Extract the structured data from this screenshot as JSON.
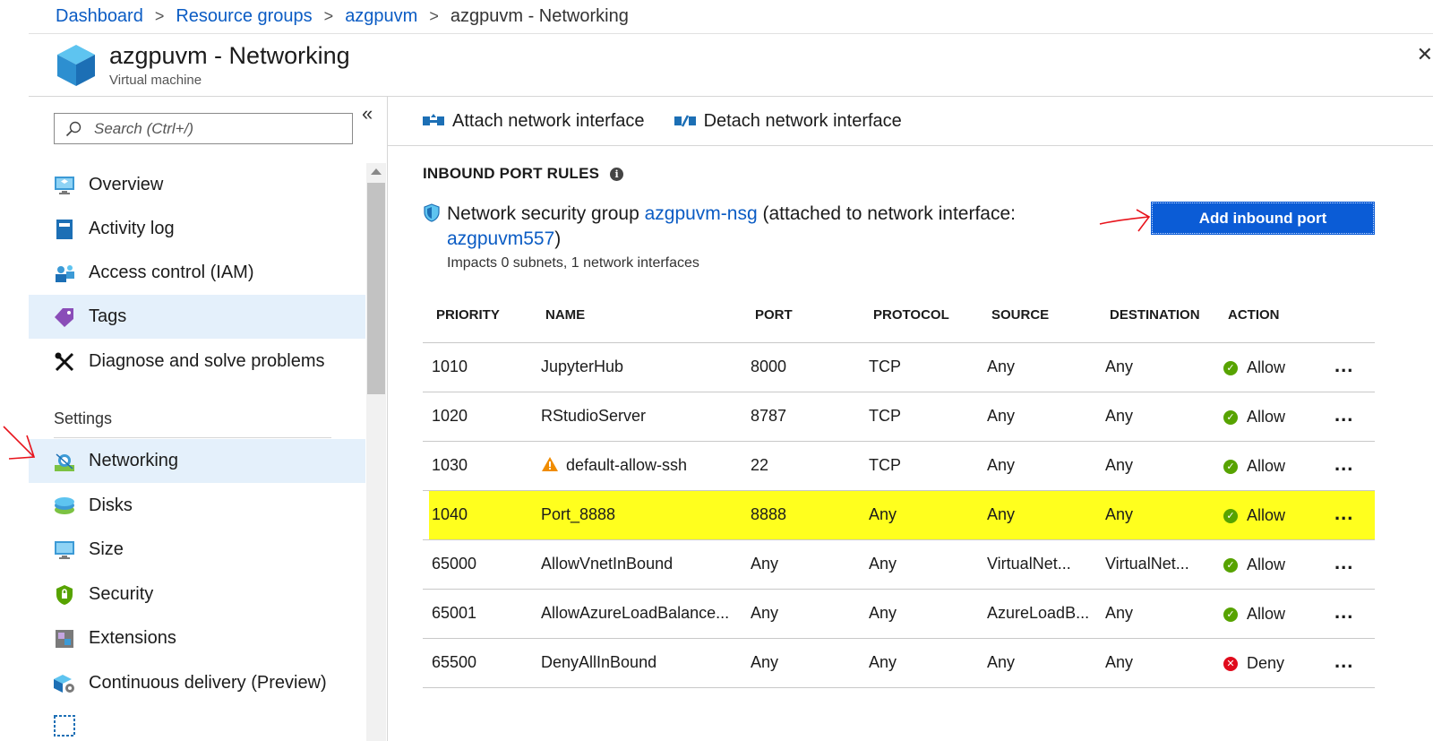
{
  "breadcrumb": {
    "items": [
      "Dashboard",
      "Resource groups",
      "azgpuvm"
    ],
    "current": "azgpuvm - Networking"
  },
  "header": {
    "title": "azgpuvm - Networking",
    "subtitle": "Virtual machine",
    "close_glyph": "✕"
  },
  "sidebar": {
    "search_placeholder": "Search (Ctrl+/)",
    "collapse_glyph": "«",
    "items": [
      {
        "label": "Overview",
        "icon": "monitor-icon"
      },
      {
        "label": "Activity log",
        "icon": "book-icon"
      },
      {
        "label": "Access control (IAM)",
        "icon": "people-icon"
      },
      {
        "label": "Tags",
        "icon": "tag-icon"
      },
      {
        "label": "Diagnose and solve problems",
        "icon": "wrench-icon"
      }
    ],
    "settings_label": "Settings",
    "settings_items": [
      {
        "label": "Networking",
        "icon": "network-icon"
      },
      {
        "label": "Disks",
        "icon": "disk-icon"
      },
      {
        "label": "Size",
        "icon": "monitor-icon"
      },
      {
        "label": "Security",
        "icon": "shield-icon"
      },
      {
        "label": "Extensions",
        "icon": "extensions-icon"
      },
      {
        "label": "Continuous delivery (Preview)",
        "icon": "delivery-icon"
      }
    ],
    "active": "Networking"
  },
  "toolbar": {
    "attach_label": "Attach network interface",
    "detach_label": "Detach network interface"
  },
  "inbound": {
    "title": "INBOUND PORT RULES",
    "nsg_prefix": "Network security group",
    "nsg_link": "azgpuvm-nsg",
    "nsg_middle": "(attached to network interface:",
    "nic_link": "azgpuvm557",
    "nsg_suffix": ")",
    "impacts": "Impacts 0 subnets, 1 network interfaces",
    "add_button": "Add inbound port"
  },
  "table": {
    "columns": [
      "PRIORITY",
      "NAME",
      "PORT",
      "PROTOCOL",
      "SOURCE",
      "DESTINATION",
      "ACTION"
    ],
    "rows": [
      {
        "priority": "1010",
        "name": "JupyterHub",
        "port": "8000",
        "protocol": "TCP",
        "source": "Any",
        "destination": "Any",
        "action": "Allow",
        "warning": false,
        "highlight": false
      },
      {
        "priority": "1020",
        "name": "RStudioServer",
        "port": "8787",
        "protocol": "TCP",
        "source": "Any",
        "destination": "Any",
        "action": "Allow",
        "warning": false,
        "highlight": false
      },
      {
        "priority": "1030",
        "name": "default-allow-ssh",
        "port": "22",
        "protocol": "TCP",
        "source": "Any",
        "destination": "Any",
        "action": "Allow",
        "warning": true,
        "highlight": false
      },
      {
        "priority": "1040",
        "name": "Port_8888",
        "port": "8888",
        "protocol": "Any",
        "source": "Any",
        "destination": "Any",
        "action": "Allow",
        "warning": false,
        "highlight": true
      },
      {
        "priority": "65000",
        "name": "AllowVnetInBound",
        "port": "Any",
        "protocol": "Any",
        "source": "VirtualNet...",
        "destination": "VirtualNet...",
        "action": "Allow",
        "warning": false,
        "highlight": false
      },
      {
        "priority": "65001",
        "name": "AllowAzureLoadBalance...",
        "port": "Any",
        "protocol": "Any",
        "source": "AzureLoadB...",
        "destination": "Any",
        "action": "Allow",
        "warning": false,
        "highlight": false
      },
      {
        "priority": "65500",
        "name": "DenyAllInBound",
        "port": "Any",
        "protocol": "Any",
        "source": "Any",
        "destination": "Any",
        "action": "Deny",
        "warning": false,
        "highlight": false
      }
    ],
    "more_glyph": "...",
    "allow_color": "#57a300",
    "deny_color": "#e00b1c",
    "highlight_color": "#ffff1e"
  },
  "colors": {
    "link": "#0b5cc4",
    "primary_button": "#0b5cd6",
    "active_nav": "#e4f0fb",
    "annotation": "#e8141c"
  }
}
